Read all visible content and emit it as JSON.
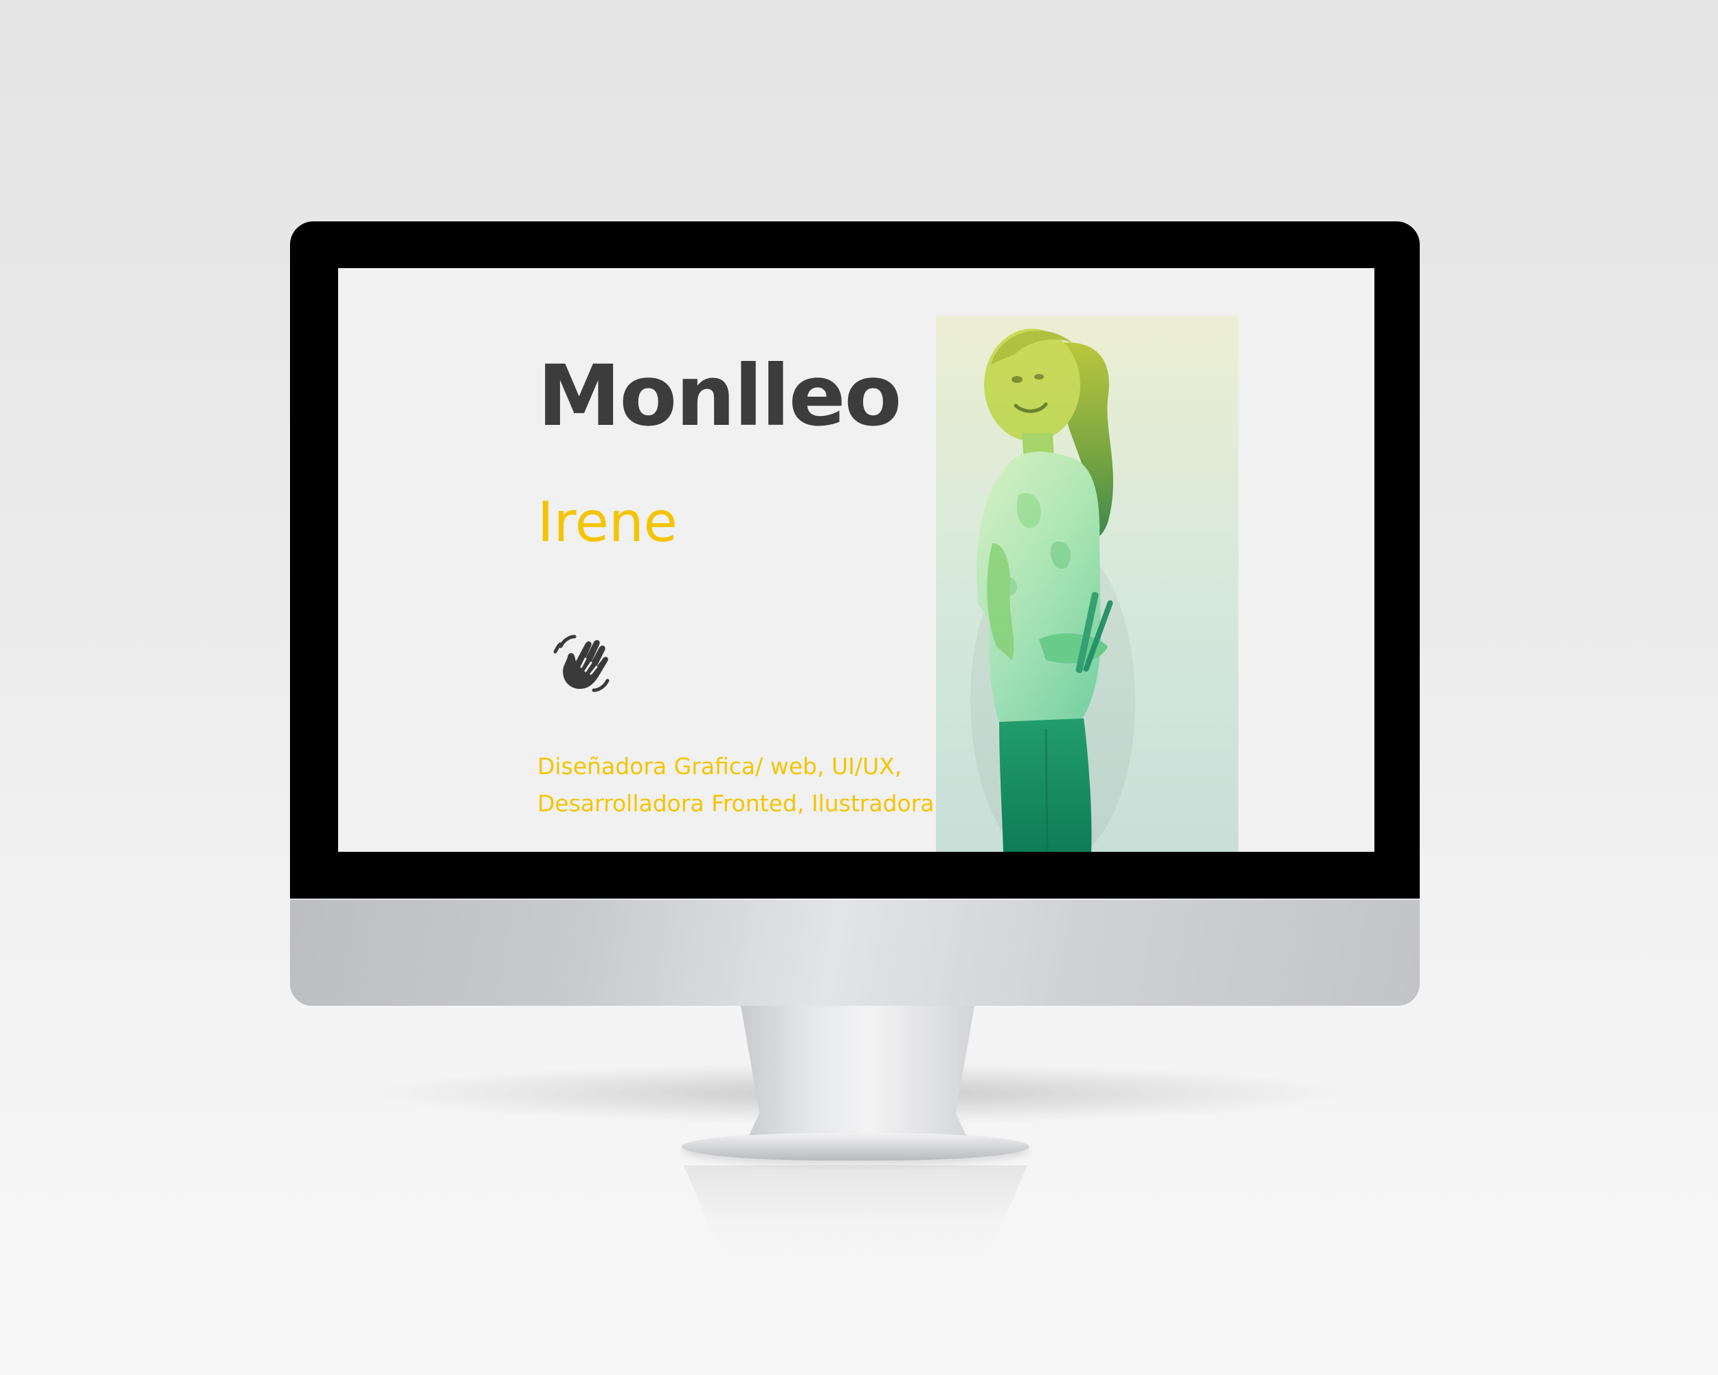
{
  "profile": {
    "surname": "Monlleo",
    "first_name": "Irene",
    "roles_line_1": "Diseñadora Grafica/ web, UI/UX,",
    "roles_line_2": "Desarrolladora Fronted, Ilustradora"
  },
  "icons": {
    "greeting": "waving-hand-icon",
    "photo": "portrait-photo"
  },
  "colors": {
    "accent": "#f5c400",
    "heading": "#3c3c3c",
    "screen_background": "#f1f1f1",
    "photo_tint_top": "#d9e24a",
    "photo_tint_bottom": "#0f8a63"
  }
}
